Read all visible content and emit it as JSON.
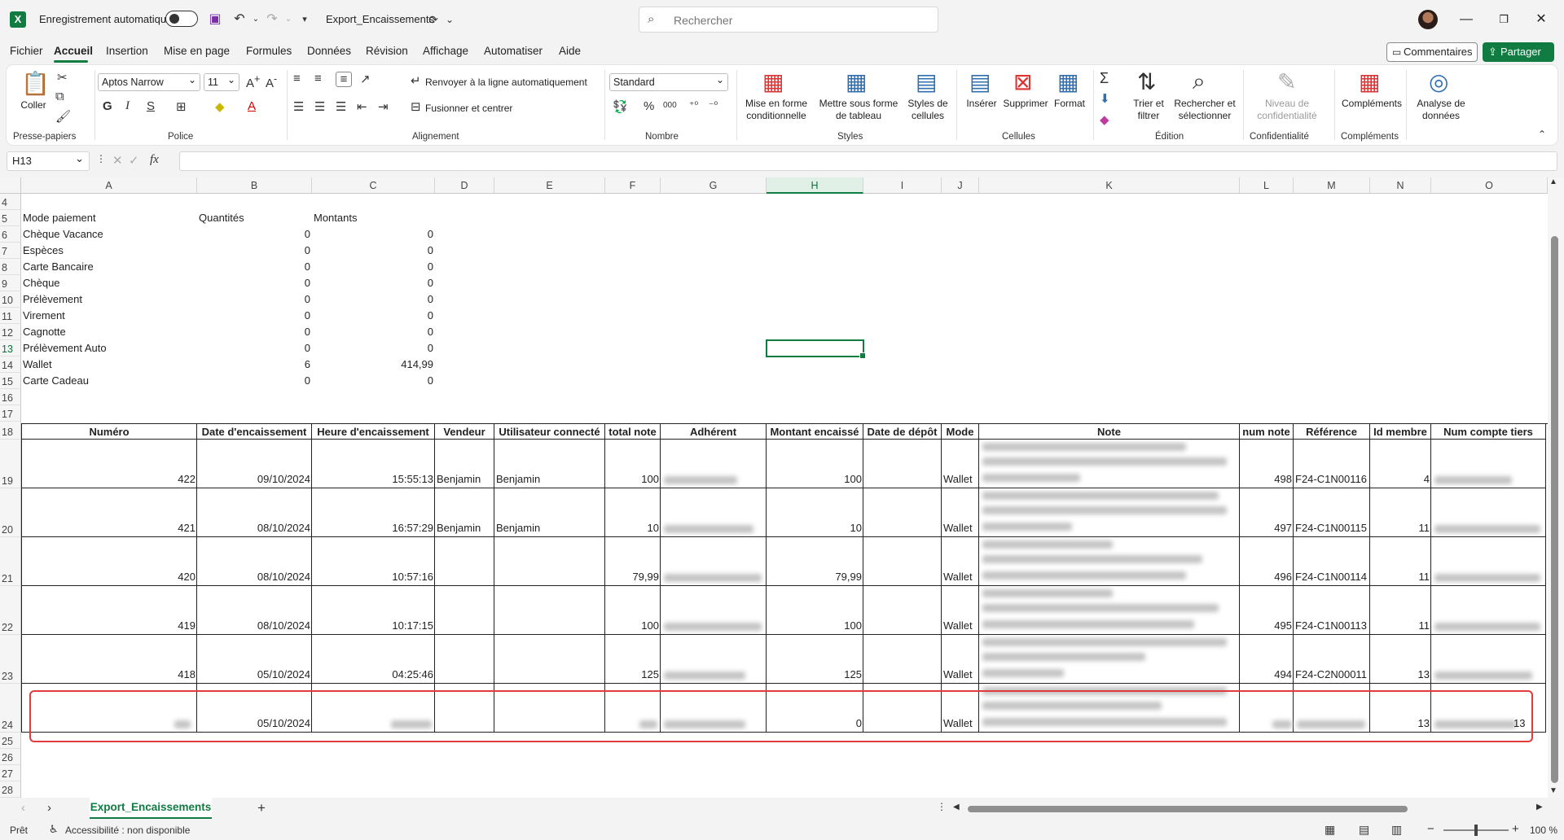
{
  "app": {
    "autosave_label": "Enregistrement automatique",
    "doc_title": "Export_Encaissements",
    "search_placeholder": "Rechercher"
  },
  "menu": [
    "Fichier",
    "Accueil",
    "Insertion",
    "Mise en page",
    "Formules",
    "Données",
    "Révision",
    "Affichage",
    "Automatiser",
    "Aide"
  ],
  "actions": {
    "comments": "Commentaires",
    "share": "Partager"
  },
  "ribbon": {
    "paste_label": "Coller",
    "font_name": "Aptos Narrow",
    "font_size": "11",
    "wrap_label": "Renvoyer à la ligne automatiquement",
    "merge_label": "Fusionner et centrer",
    "number_format": "Standard",
    "cond_format": "Mise en forme conditionnelle",
    "table_format": "Mettre sous forme de tableau",
    "cell_styles": "Styles de cellules",
    "insert": "Insérer",
    "delete": "Supprimer",
    "format": "Format",
    "sort_filter": "Trier et filtrer",
    "find_select": "Rechercher et sélectionner",
    "sensitivity": "Niveau de confidentialité",
    "addins": "Compléments",
    "analyze": "Analyse de données",
    "groups": [
      "Presse-papiers",
      "Police",
      "Alignement",
      "Nombre",
      "Styles",
      "Cellules",
      "Édition",
      "Confidentialité",
      "Compléments"
    ]
  },
  "formula_bar": {
    "name_box": "H13",
    "formula": ""
  },
  "columns": [
    "A",
    "B",
    "C",
    "D",
    "E",
    "F",
    "G",
    "H",
    "I",
    "J",
    "K",
    "L",
    "M",
    "N",
    "O"
  ],
  "rows": [
    "4",
    "5",
    "6",
    "7",
    "8",
    "9",
    "10",
    "11",
    "12",
    "13",
    "14",
    "15",
    "16",
    "17",
    "18",
    "19",
    "20",
    "21",
    "22",
    "23",
    "24",
    "25",
    "26",
    "27",
    "28"
  ],
  "summary": {
    "headers": [
      "Mode paiement",
      "Quantités",
      "Montants"
    ],
    "rows": [
      [
        "Chèque Vacance",
        "0",
        "0"
      ],
      [
        "Espèces",
        "0",
        "0"
      ],
      [
        "Carte Bancaire",
        "0",
        "0"
      ],
      [
        "Chèque",
        "0",
        "0"
      ],
      [
        "Prélèvement",
        "0",
        "0"
      ],
      [
        "Virement",
        "0",
        "0"
      ],
      [
        "Cagnotte",
        "0",
        "0"
      ],
      [
        "Prélèvement Auto",
        "0",
        "0"
      ],
      [
        "Wallet",
        "6",
        "414,99"
      ],
      [
        "Carte Cadeau",
        "0",
        "0"
      ]
    ]
  },
  "table": {
    "headers": [
      "Numéro",
      "Date d'encaissement",
      "Heure d'encaissement",
      "Vendeur",
      "Utilisateur connecté",
      "total note",
      "Adhérent",
      "Montant encaissé",
      "Date de dépôt",
      "Mode",
      "Note",
      "num note",
      "Référence",
      "Id membre",
      "Num compte tiers"
    ],
    "rows": [
      {
        "numero": "422",
        "date": "09/10/2024",
        "heure": "15:55:13",
        "vendeur": "Benjamin",
        "utilisateur": "Benjamin",
        "total": "100",
        "montant": "100",
        "mode": "Wallet",
        "num_note": "498",
        "reference": "F24-C1N00116",
        "id_membre": "4",
        "compte_suffix": ""
      },
      {
        "numero": "421",
        "date": "08/10/2024",
        "heure": "16:57:29",
        "vendeur": "Benjamin",
        "utilisateur": "Benjamin",
        "total": "10",
        "montant": "10",
        "mode": "Wallet",
        "num_note": "497",
        "reference": "F24-C1N00115",
        "id_membre": "11",
        "compte_suffix": ""
      },
      {
        "numero": "420",
        "date": "08/10/2024",
        "heure": "10:57:16",
        "vendeur": "",
        "utilisateur": "",
        "total": "79,99",
        "montant": "79,99",
        "mode": "Wallet",
        "num_note": "496",
        "reference": "F24-C1N00114",
        "id_membre": "11",
        "compte_suffix": ""
      },
      {
        "numero": "419",
        "date": "08/10/2024",
        "heure": "10:17:15",
        "vendeur": "",
        "utilisateur": "",
        "total": "100",
        "montant": "100",
        "mode": "Wallet",
        "num_note": "495",
        "reference": "F24-C1N00113",
        "id_membre": "11",
        "compte_suffix": ""
      },
      {
        "numero": "418",
        "date": "05/10/2024",
        "heure": "04:25:46",
        "vendeur": "",
        "utilisateur": "",
        "total": "125",
        "montant": "125",
        "mode": "Wallet",
        "num_note": "494",
        "reference": "F24-C2N00011",
        "id_membre": "13",
        "compte_suffix": ""
      },
      {
        "numero": "",
        "date": "05/10/2024",
        "heure": "",
        "vendeur": "",
        "utilisateur": "",
        "total": "",
        "montant": "0",
        "mode": "Wallet",
        "num_note": "",
        "reference": "",
        "id_membre": "13",
        "compte_suffix": "13"
      }
    ]
  },
  "sheet_tab": "Export_Encaissements",
  "status": {
    "ready": "Prêt",
    "accessibility": "Accessibilité : non disponible",
    "zoom": "100 %"
  }
}
